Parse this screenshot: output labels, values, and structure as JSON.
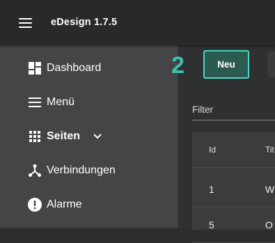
{
  "app": {
    "title": "eDesign 1.7.5"
  },
  "sidebar": {
    "items": [
      {
        "label": "Dashboard",
        "icon": "dashboard-icon"
      },
      {
        "label": "Menü",
        "icon": "menu-lines-icon"
      },
      {
        "label": "Seiten",
        "icon": "grid-icon",
        "expanded_indicator": "chevron-down-icon"
      },
      {
        "label": "Verbindungen",
        "icon": "network-icon"
      },
      {
        "label": "Alarme",
        "icon": "alert-icon"
      }
    ]
  },
  "main": {
    "step_number": "2",
    "new_button_label": "Neu",
    "filter_label": "Filter",
    "table": {
      "headers": [
        "Id",
        "Tit"
      ],
      "rows": [
        [
          "1",
          "W"
        ],
        [
          "5",
          "O"
        ]
      ]
    }
  },
  "colors": {
    "accent": "#4ed6c0",
    "step_number": "#3fbfae",
    "topbar": "#28292a",
    "sidebar": "#444546"
  }
}
